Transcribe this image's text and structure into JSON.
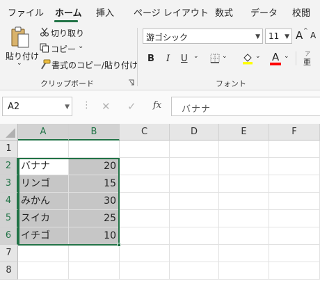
{
  "tabs": [
    "ファイル",
    "ホーム",
    "挿入",
    "ページ レイアウト",
    "数式",
    "データ",
    "校閲"
  ],
  "ribbon": {
    "clipboard": {
      "paste_label": "貼り付け",
      "cut_label": "切り取り",
      "copy_label": "コピー",
      "format_painter_label": "書式のコピー/貼り付け",
      "group_label": "クリップボード"
    },
    "font": {
      "font_name": "游ゴシック",
      "font_size": "11",
      "bold": "B",
      "italic": "I",
      "underline": "U",
      "grow": "A",
      "shrink": "A",
      "font_color_label": "A",
      "phonetic_label": "亜",
      "group_label": "フォント"
    }
  },
  "formula_bar": {
    "name_box": "A2",
    "separator": "⋮",
    "cancel": "✕",
    "enter": "✓",
    "fx": "fx",
    "content": "バナナ"
  },
  "sheet": {
    "columns": [
      "A",
      "B",
      "C",
      "D",
      "E",
      "F"
    ],
    "rows": [
      "1",
      "2",
      "3",
      "4",
      "5",
      "6",
      "7",
      "8"
    ],
    "data": [
      {
        "name": "バナナ",
        "value": "20"
      },
      {
        "name": "リンゴ",
        "value": "15"
      },
      {
        "name": "みかん",
        "value": "30"
      },
      {
        "name": "スイカ",
        "value": "25"
      },
      {
        "name": "イチゴ",
        "value": "10"
      }
    ]
  },
  "colors": {
    "accent": "#217346",
    "selection_fill": "#c6c6c6",
    "highlight_yellow": "#ffff00",
    "font_red": "#ff0000"
  }
}
